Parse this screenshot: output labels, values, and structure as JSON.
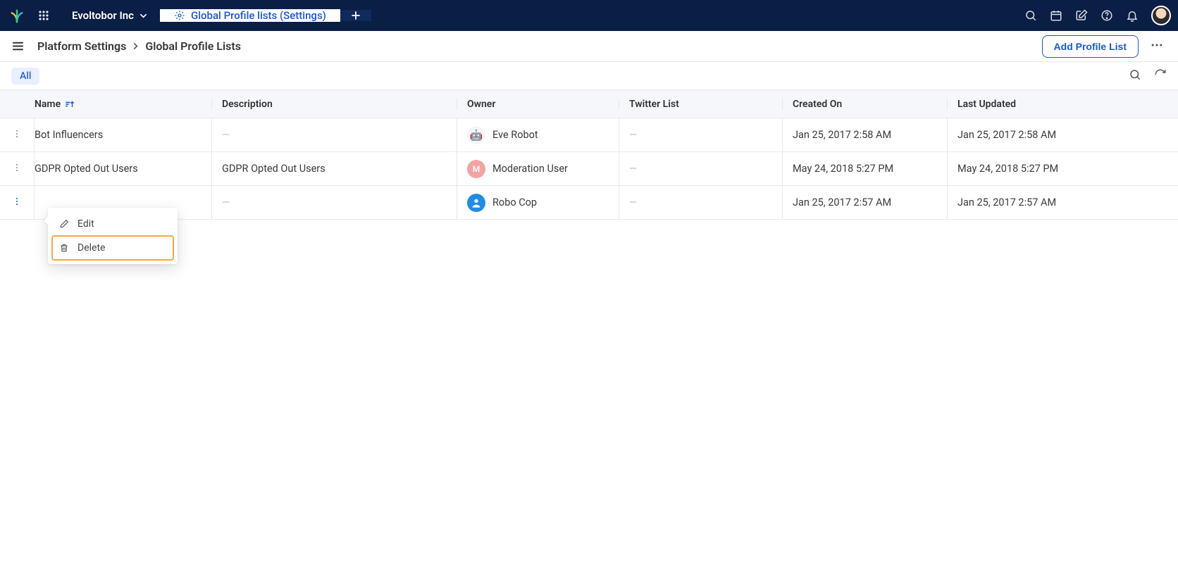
{
  "topbar": {
    "workspace_label": "Evoltobor Inc",
    "tab_label": "Global Profile lists (Settings)"
  },
  "subbar": {
    "breadcrumb_root": "Platform Settings",
    "breadcrumb_current": "Global Profile Lists",
    "add_button": "Add Profile List"
  },
  "filterbar": {
    "chip_all": "All"
  },
  "table": {
    "headers": {
      "name": "Name",
      "description": "Description",
      "owner": "Owner",
      "twitter": "Twitter List",
      "created": "Created On",
      "updated": "Last Updated"
    },
    "rows": [
      {
        "name": "Bot Influencers",
        "description": "—",
        "owner": "Eve Robot",
        "owner_avatar_kind": "eve",
        "owner_initial": "",
        "twitter": "—",
        "created": "Jan 25, 2017 2:58 AM",
        "updated": "Jan 25, 2017 2:58 AM"
      },
      {
        "name": "GDPR Opted Out Users",
        "description": "GDPR Opted Out Users",
        "owner": "Moderation User",
        "owner_avatar_kind": "mod",
        "owner_initial": "M",
        "twitter": "—",
        "created": "May 24, 2018 5:27 PM",
        "updated": "May 24, 2018 5:27 PM"
      },
      {
        "name": "",
        "description": "—",
        "owner": "Robo Cop",
        "owner_avatar_kind": "robo",
        "owner_initial": "",
        "twitter": "—",
        "created": "Jan 25, 2017 2:57 AM",
        "updated": "Jan 25, 2017 2:57 AM"
      }
    ]
  },
  "contextmenu": {
    "edit": "Edit",
    "delete": "Delete"
  }
}
